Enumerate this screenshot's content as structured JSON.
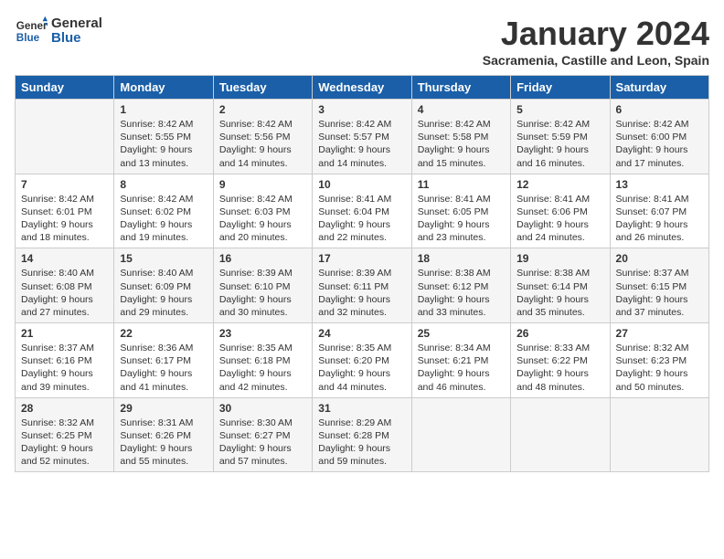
{
  "header": {
    "logo_line1": "General",
    "logo_line2": "Blue",
    "month": "January 2024",
    "location": "Sacramenia, Castille and Leon, Spain"
  },
  "days_of_week": [
    "Sunday",
    "Monday",
    "Tuesday",
    "Wednesday",
    "Thursday",
    "Friday",
    "Saturday"
  ],
  "weeks": [
    [
      {
        "day": "",
        "content": ""
      },
      {
        "day": "1",
        "content": "Sunrise: 8:42 AM\nSunset: 5:55 PM\nDaylight: 9 hours\nand 13 minutes."
      },
      {
        "day": "2",
        "content": "Sunrise: 8:42 AM\nSunset: 5:56 PM\nDaylight: 9 hours\nand 14 minutes."
      },
      {
        "day": "3",
        "content": "Sunrise: 8:42 AM\nSunset: 5:57 PM\nDaylight: 9 hours\nand 14 minutes."
      },
      {
        "day": "4",
        "content": "Sunrise: 8:42 AM\nSunset: 5:58 PM\nDaylight: 9 hours\nand 15 minutes."
      },
      {
        "day": "5",
        "content": "Sunrise: 8:42 AM\nSunset: 5:59 PM\nDaylight: 9 hours\nand 16 minutes."
      },
      {
        "day": "6",
        "content": "Sunrise: 8:42 AM\nSunset: 6:00 PM\nDaylight: 9 hours\nand 17 minutes."
      }
    ],
    [
      {
        "day": "7",
        "content": "Sunrise: 8:42 AM\nSunset: 6:01 PM\nDaylight: 9 hours\nand 18 minutes."
      },
      {
        "day": "8",
        "content": "Sunrise: 8:42 AM\nSunset: 6:02 PM\nDaylight: 9 hours\nand 19 minutes."
      },
      {
        "day": "9",
        "content": "Sunrise: 8:42 AM\nSunset: 6:03 PM\nDaylight: 9 hours\nand 20 minutes."
      },
      {
        "day": "10",
        "content": "Sunrise: 8:41 AM\nSunset: 6:04 PM\nDaylight: 9 hours\nand 22 minutes."
      },
      {
        "day": "11",
        "content": "Sunrise: 8:41 AM\nSunset: 6:05 PM\nDaylight: 9 hours\nand 23 minutes."
      },
      {
        "day": "12",
        "content": "Sunrise: 8:41 AM\nSunset: 6:06 PM\nDaylight: 9 hours\nand 24 minutes."
      },
      {
        "day": "13",
        "content": "Sunrise: 8:41 AM\nSunset: 6:07 PM\nDaylight: 9 hours\nand 26 minutes."
      }
    ],
    [
      {
        "day": "14",
        "content": "Sunrise: 8:40 AM\nSunset: 6:08 PM\nDaylight: 9 hours\nand 27 minutes."
      },
      {
        "day": "15",
        "content": "Sunrise: 8:40 AM\nSunset: 6:09 PM\nDaylight: 9 hours\nand 29 minutes."
      },
      {
        "day": "16",
        "content": "Sunrise: 8:39 AM\nSunset: 6:10 PM\nDaylight: 9 hours\nand 30 minutes."
      },
      {
        "day": "17",
        "content": "Sunrise: 8:39 AM\nSunset: 6:11 PM\nDaylight: 9 hours\nand 32 minutes."
      },
      {
        "day": "18",
        "content": "Sunrise: 8:38 AM\nSunset: 6:12 PM\nDaylight: 9 hours\nand 33 minutes."
      },
      {
        "day": "19",
        "content": "Sunrise: 8:38 AM\nSunset: 6:14 PM\nDaylight: 9 hours\nand 35 minutes."
      },
      {
        "day": "20",
        "content": "Sunrise: 8:37 AM\nSunset: 6:15 PM\nDaylight: 9 hours\nand 37 minutes."
      }
    ],
    [
      {
        "day": "21",
        "content": "Sunrise: 8:37 AM\nSunset: 6:16 PM\nDaylight: 9 hours\nand 39 minutes."
      },
      {
        "day": "22",
        "content": "Sunrise: 8:36 AM\nSunset: 6:17 PM\nDaylight: 9 hours\nand 41 minutes."
      },
      {
        "day": "23",
        "content": "Sunrise: 8:35 AM\nSunset: 6:18 PM\nDaylight: 9 hours\nand 42 minutes."
      },
      {
        "day": "24",
        "content": "Sunrise: 8:35 AM\nSunset: 6:20 PM\nDaylight: 9 hours\nand 44 minutes."
      },
      {
        "day": "25",
        "content": "Sunrise: 8:34 AM\nSunset: 6:21 PM\nDaylight: 9 hours\nand 46 minutes."
      },
      {
        "day": "26",
        "content": "Sunrise: 8:33 AM\nSunset: 6:22 PM\nDaylight: 9 hours\nand 48 minutes."
      },
      {
        "day": "27",
        "content": "Sunrise: 8:32 AM\nSunset: 6:23 PM\nDaylight: 9 hours\nand 50 minutes."
      }
    ],
    [
      {
        "day": "28",
        "content": "Sunrise: 8:32 AM\nSunset: 6:25 PM\nDaylight: 9 hours\nand 52 minutes."
      },
      {
        "day": "29",
        "content": "Sunrise: 8:31 AM\nSunset: 6:26 PM\nDaylight: 9 hours\nand 55 minutes."
      },
      {
        "day": "30",
        "content": "Sunrise: 8:30 AM\nSunset: 6:27 PM\nDaylight: 9 hours\nand 57 minutes."
      },
      {
        "day": "31",
        "content": "Sunrise: 8:29 AM\nSunset: 6:28 PM\nDaylight: 9 hours\nand 59 minutes."
      },
      {
        "day": "",
        "content": ""
      },
      {
        "day": "",
        "content": ""
      },
      {
        "day": "",
        "content": ""
      }
    ]
  ]
}
